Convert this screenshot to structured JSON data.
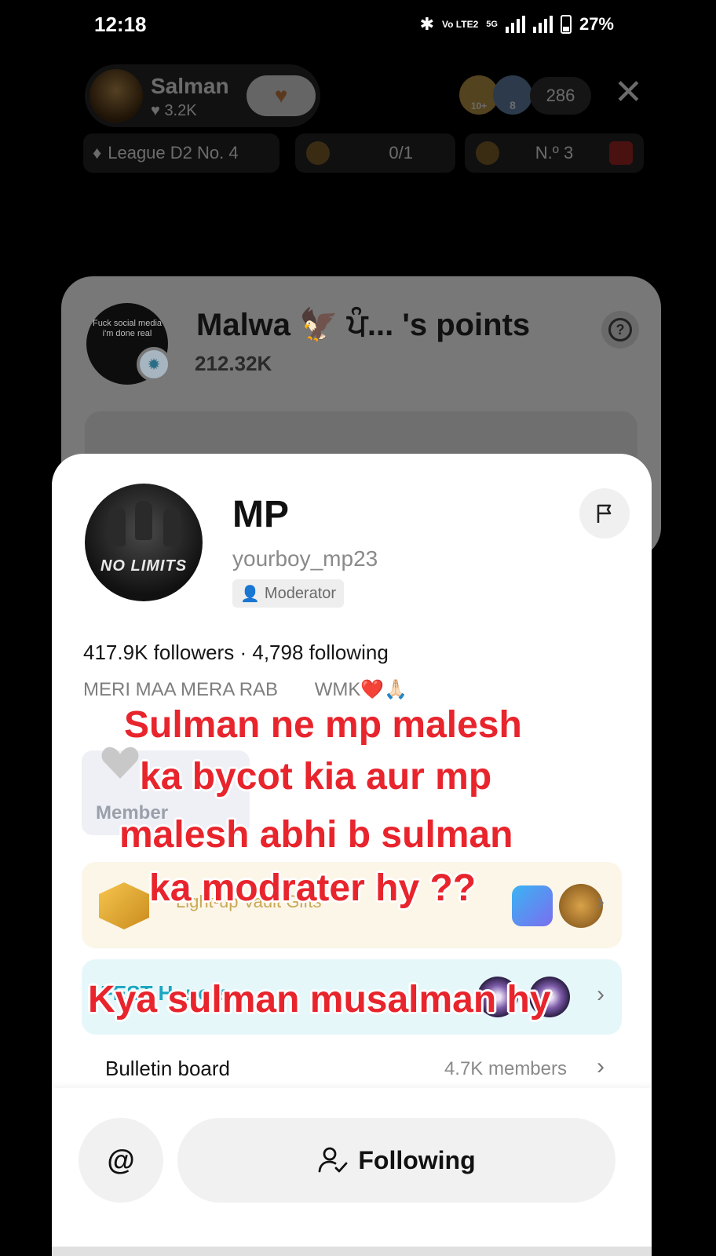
{
  "status_bar": {
    "time": "12:18",
    "network": "Vo LTE2",
    "net_type": "5G",
    "battery": "27%"
  },
  "live": {
    "host_name": "Salman",
    "host_likes": "3.2K",
    "viewer_badge_1": "10+",
    "viewer_badge_2": "8",
    "viewer_count": "286",
    "league": "League D2 No. 4",
    "gift_progress": "0/1",
    "rank": "N.º 3"
  },
  "points_panel": {
    "title": "Malwa 🦅 ਪੰ...   's points",
    "points": "212.32K",
    "avatar_text": "Fuck social media i'm done real"
  },
  "profile": {
    "name": "MP",
    "handle": "yourboy_mp23",
    "badge": "Moderator",
    "followers": "417.9K followers",
    "following": "4,798 following",
    "bio": "MERI MAA MERA RAB       WMK❤️🙏🏻",
    "avatar_text": "NO LIMITS",
    "member_label": "Member",
    "light_label": "Light-up Vault Gifts",
    "fest_label": "FEST Honors",
    "bulletin_label": "Bulletin board",
    "bulletin_count": "4.7K members",
    "mention_label": "@",
    "following_button": "Following"
  },
  "overlay": {
    "line1": "Sulman ne mp malesh",
    "line2": "ka bycot kia aur mp",
    "line3": "malesh abhi b sulman",
    "line4": "ka modrater hy ??",
    "line5": "Kya sulman musalman hy"
  },
  "colors": {
    "overlay_red": "#e8242c",
    "fest_teal": "#1aa5c0",
    "sheet_bg": "#ffffff"
  }
}
